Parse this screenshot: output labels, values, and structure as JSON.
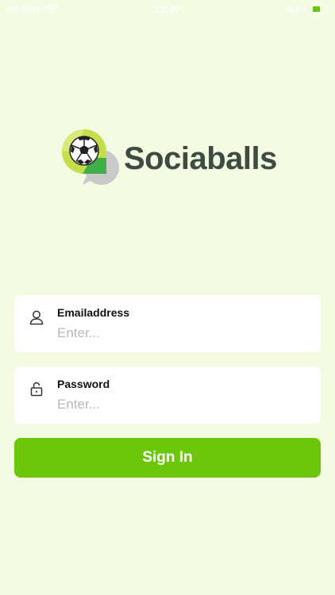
{
  "status_bar": {
    "carrier": "No SIM",
    "time": "13:07",
    "battery": "60%",
    "battery_level": 0.6
  },
  "logo": {
    "brand_name": "Sociaballs",
    "icon": "soccer-ball-chat-bubble-icon"
  },
  "form": {
    "email": {
      "label": "Emailaddress",
      "placeholder": "Enter...",
      "value": "",
      "icon": "user-icon"
    },
    "password": {
      "label": "Password",
      "placeholder": "Enter...",
      "value": "",
      "icon": "lock-icon"
    },
    "submit_label": "Sign In"
  },
  "colors": {
    "background": "#f3fbe3",
    "accent": "#6cc70b",
    "brand_text": "#3f4a40"
  }
}
